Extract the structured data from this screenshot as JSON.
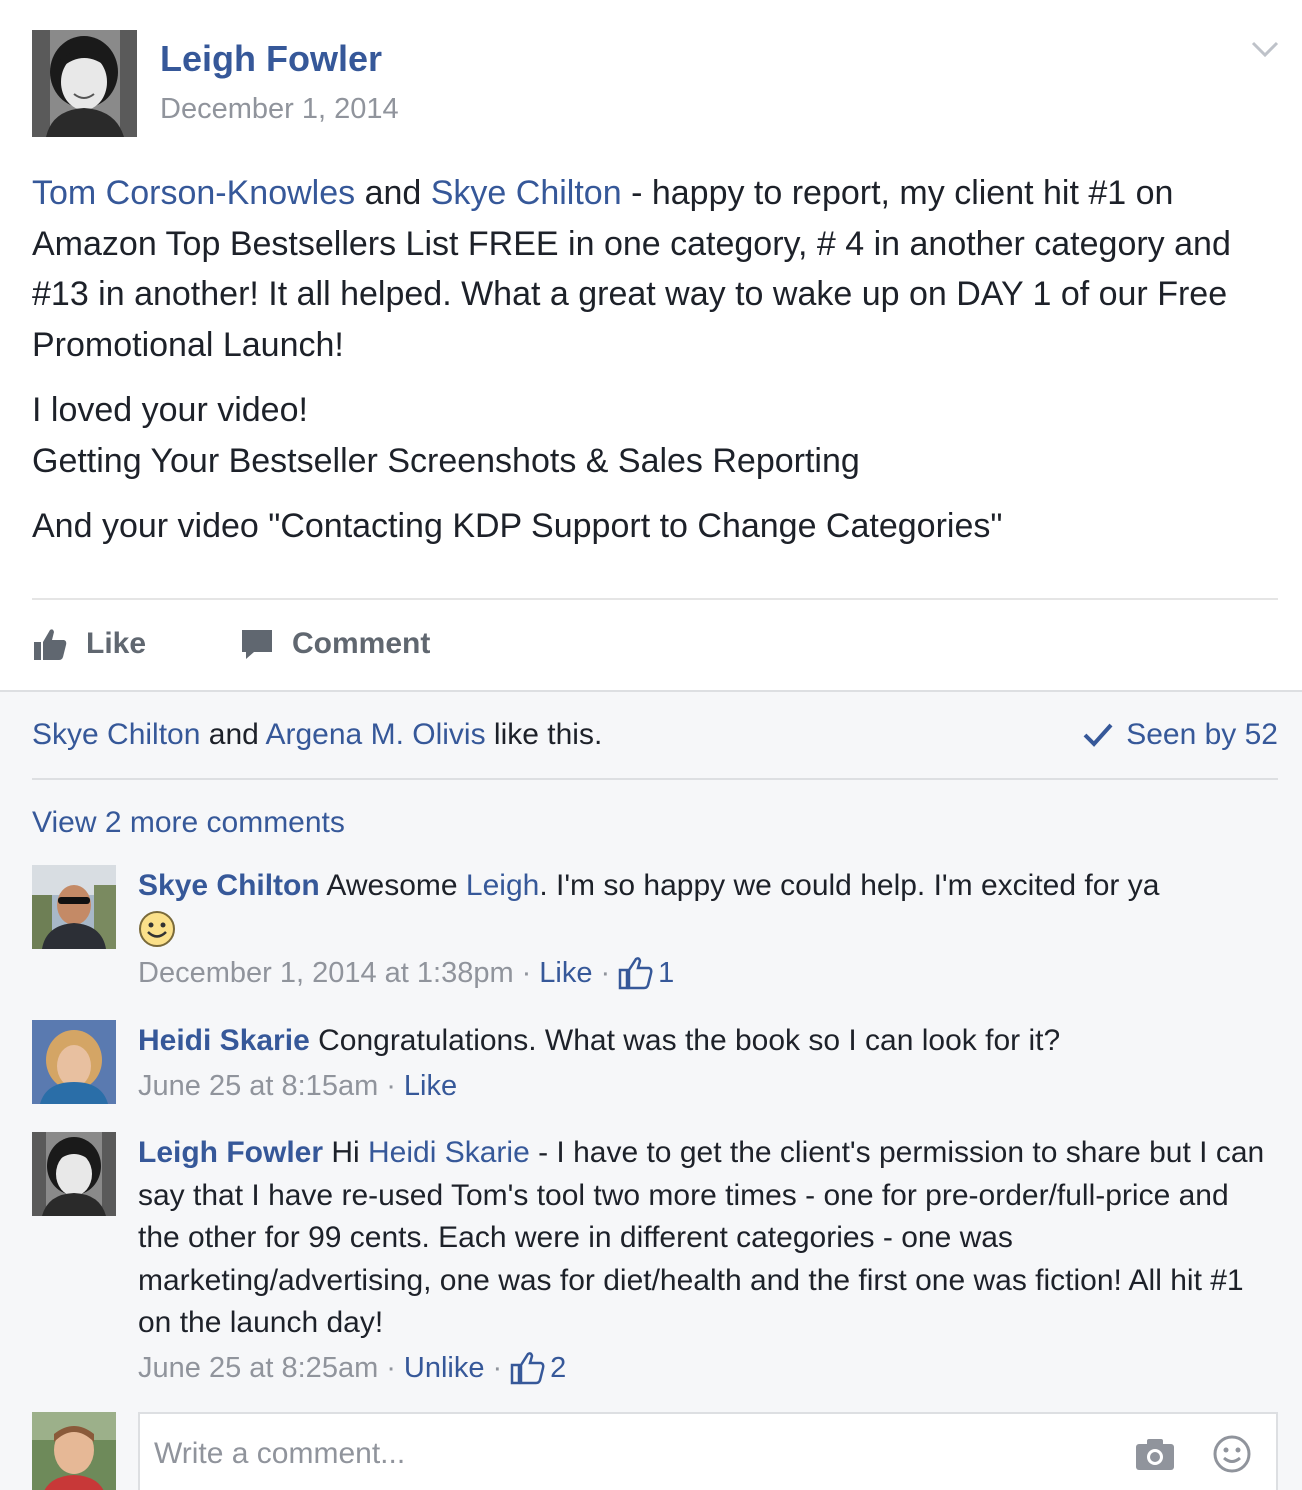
{
  "post": {
    "author": "Leigh Fowler",
    "date": "December 1, 2014",
    "tag1": "Tom Corson-Knowles",
    "and1": " and ",
    "tag2": "Skye Chilton",
    "text1": " - happy to report, my client hit #1 on Amazon Top Bestsellers List FREE in one category, # 4 in another category and #13 in another! It all helped. What a great way to wake up on DAY 1 of our Free Promotional Launch!",
    "text2_line1": "I loved your video!",
    "text2_line2": "Getting Your Bestseller Screenshots & Sales Reporting",
    "text3": "And your video \"Contacting KDP Support to Change Categories\"",
    "like_label": "Like",
    "comment_label": "Comment"
  },
  "feedback": {
    "liker1": "Skye Chilton",
    "and": " and ",
    "liker2": "Argena M. Olivis",
    "like_suffix": " like this.",
    "seen_label": "Seen by 52",
    "view_more": "View 2 more comments"
  },
  "comments": [
    {
      "name": "Skye Chilton",
      "pre": " Awesome ",
      "mention": "Leigh",
      "post": ". I'm so happy we could help. I'm excited for ya",
      "time": "December 1, 2014 at 1:38pm",
      "action": "Like",
      "likes": "1"
    },
    {
      "name": "Heidi Skarie",
      "pre": " Congratulations. What was the book so I can look for it?",
      "time": "June 25 at 8:15am",
      "action": "Like"
    },
    {
      "name": "Leigh Fowler",
      "pre": " Hi ",
      "mention": "Heidi Skarie",
      "post": " - I have to get the client's permission to share but I can say that I have re-used Tom's tool two more times - one for pre-order/full-price and the other for 99 cents. Each were in different categories - one was marketing/advertising, one was for diet/health and the first one was fiction! All hit #1 on the launch day!",
      "time": "June 25 at 8:25am",
      "action": "Unlike",
      "likes": "2"
    }
  ],
  "composer": {
    "placeholder": "Write a comment..."
  },
  "icons": {
    "like": "thumbs-up-icon",
    "comment": "speech-bubble-icon",
    "seen": "checkmark-icon",
    "camera": "camera-icon",
    "emoji": "smiley-icon",
    "menu": "chevron-down-icon"
  },
  "colors": {
    "link": "#365899",
    "meta": "#90949c",
    "feedback_bg": "#f6f7f9"
  }
}
